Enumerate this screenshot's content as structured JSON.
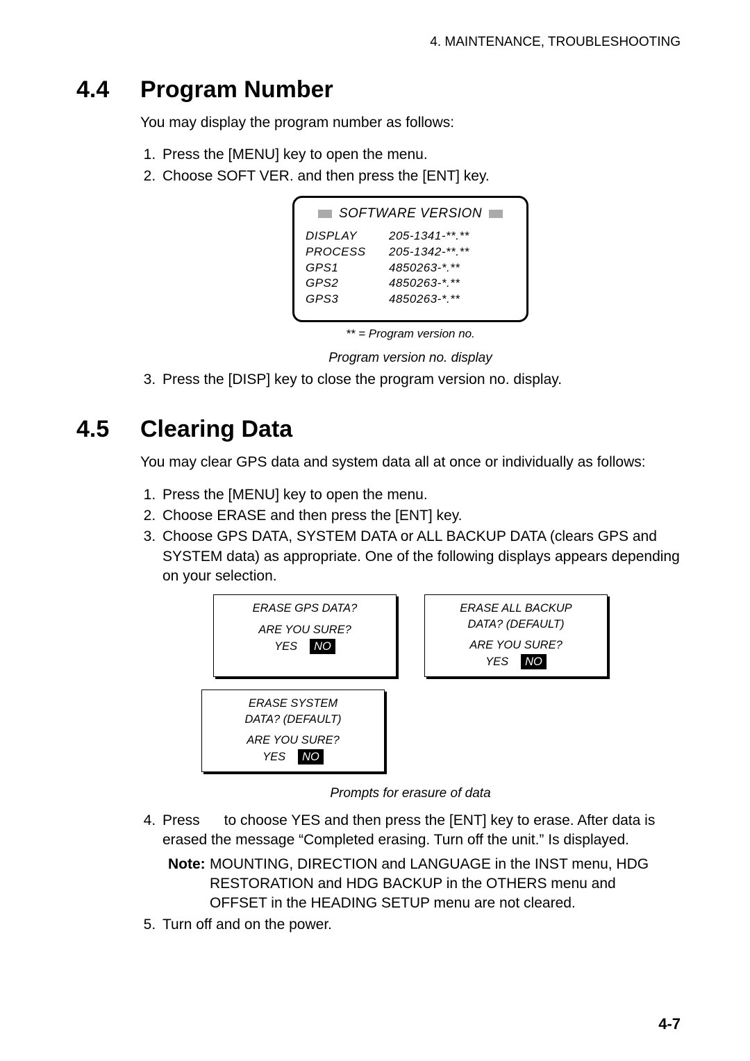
{
  "running_head": "4. MAINTENANCE, TROUBLESHOOTING",
  "section_4_4": {
    "num": "4.4",
    "title": "Program Number",
    "lead": "You may display the program number as follows:",
    "step1": "Press the [MENU] key to open the menu.",
    "step2": "Choose SOFT VER. and then press the [ENT] key.",
    "sv": {
      "title": "SOFTWARE VERSION",
      "rows": {
        "r0": {
          "label": "DISPLAY",
          "value": "205-1341-**.**"
        },
        "r1": {
          "label": "PROCESS",
          "value": "205-1342-**.**"
        },
        "r2": {
          "label": "GPS1",
          "value": "4850263-*.**"
        },
        "r3": {
          "label": "GPS2",
          "value": "4850263-*.**"
        },
        "r4": {
          "label": "GPS3",
          "value": "4850263-*.**"
        }
      },
      "star_note": "** = Program version no.",
      "caption": "Program version no. display"
    },
    "step3": "Press the [DISP] key to close the program version no. display."
  },
  "section_4_5": {
    "num": "4.5",
    "title": "Clearing Data",
    "lead": "You may clear GPS data and system data all at once or individually as follows:",
    "step1": "Press the [MENU] key to open the menu.",
    "step2": "Choose ERASE and then press the [ENT] key.",
    "step3": "Choose GPS DATA, SYSTEM DATA or ALL BACKUP DATA (clears GPS and SYSTEM data) as appropriate. One of the following displays appears depending on your selection.",
    "prompts": {
      "gps": {
        "q": "ERASE GPS DATA?",
        "sure": "ARE YOU SURE?",
        "yes": "YES",
        "no": "NO"
      },
      "backup": {
        "q1": "ERASE ALL BACKUP",
        "q2": "DATA? (DEFAULT)",
        "sure": "ARE YOU SURE?",
        "yes": "YES",
        "no": "NO"
      },
      "system": {
        "q1": "ERASE SYSTEM",
        "q2": "DATA? (DEFAULT)",
        "sure": "ARE YOU SURE?",
        "yes": "YES",
        "no": "NO"
      }
    },
    "prompts_caption": "Prompts for erasure of data",
    "step4": "Press      to choose YES and then press the [ENT] key to erase. After data is erased the message “Completed erasing. Turn off the unit.” Is displayed.",
    "note_label": "Note:",
    "note_line1": "MOUNTING, DIRECTION and LANGUAGE in the INST menu, HDG",
    "note_line2": "RESTORATION and HDG BACKUP in the OTHERS menu and",
    "note_line3": "OFFSET in the HEADING SETUP menu are not cleared.",
    "step5": "Turn off and on the power."
  },
  "page_number": "4-7"
}
